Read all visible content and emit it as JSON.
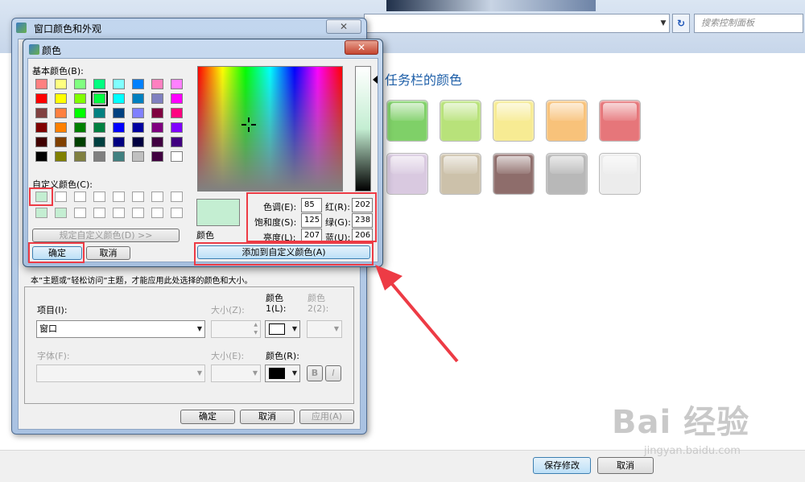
{
  "control_panel": {
    "search_placeholder": "搜索控制面板",
    "heading": "任务栏的颜色",
    "swatches_row1": [
      "#7fd068",
      "#b8e27a",
      "#f7eb93",
      "#f8c27a",
      "#e6767a"
    ],
    "swatches_row2": [
      "#d9c9e0",
      "#ccc1aa",
      "#8e6d6b",
      "#b8b8b8",
      "#ececec"
    ],
    "save_button": "保存修改",
    "cancel_button": "取消",
    "refresh_icon": "refresh-icon",
    "watermark": "Bai 经验",
    "watermark_url": "jingyan.baidu.com"
  },
  "window_color_dialog": {
    "title": "窗口颜色和外观",
    "close_label": "✕",
    "note": "本”主题或“轻松访问”主题，才能应用此处选择的颜色和大小。",
    "item_label": "项目(I):",
    "item_value": "窗口",
    "size_label_z": "大小(Z):",
    "color1_label": "颜色",
    "color1_sub": "1(L):",
    "color2_label": "颜色",
    "color2_sub": "2(2):",
    "font_label": "字体(F):",
    "size_label_e": "大小(E):",
    "font_color_label": "颜色(R):",
    "bold_label": "B",
    "italic_label": "I",
    "ok_button": "确定",
    "cancel_button": "取消",
    "apply_button": "应用(A)"
  },
  "color_dialog": {
    "title": "颜色",
    "close_label": "✕",
    "basic_colors_label": "基本颜色(B):",
    "custom_colors_label": "自定义颜色(C):",
    "define_custom_button": "规定自定义颜色(D) >>",
    "ok_button": "确定",
    "cancel_button": "取消",
    "preview_label": "颜色",
    "add_custom_button": "添加到自定义颜色(A)",
    "hue_label": "色调(E):",
    "hue_value": "85",
    "sat_label": "饱和度(S):",
    "sat_value": "125",
    "lum_label": "亮度(L):",
    "lum_value": "207",
    "red_label": "红(R):",
    "red_value": "202",
    "green_label": "绿(G):",
    "green_value": "238",
    "blue_label": "蓝(U):",
    "blue_value": "206",
    "selected_color": "#c4eed2",
    "basic_colors": [
      [
        "#ff8080",
        "#ffff80",
        "#80ff80",
        "#00ff80",
        "#80ffff",
        "#0080ff",
        "#ff80c0",
        "#ff80ff"
      ],
      [
        "#ff0000",
        "#ffff00",
        "#80ff00",
        "#00ff40",
        "#00ffff",
        "#0080c0",
        "#8080c0",
        "#ff00ff"
      ],
      [
        "#804040",
        "#ff8040",
        "#00ff00",
        "#008080",
        "#004080",
        "#8080ff",
        "#800040",
        "#ff0080"
      ],
      [
        "#800000",
        "#ff8000",
        "#008000",
        "#008040",
        "#0000ff",
        "#0000a0",
        "#800080",
        "#8000ff"
      ],
      [
        "#400000",
        "#804000",
        "#004000",
        "#004040",
        "#000080",
        "#000040",
        "#400040",
        "#400080"
      ],
      [
        "#000000",
        "#808000",
        "#808040",
        "#808080",
        "#408080",
        "#c0c0c0",
        "#400040",
        "#ffffff"
      ]
    ],
    "custom_colors": [
      [
        "#c4eed2",
        "#ffffff",
        "#ffffff",
        "#ffffff",
        "#ffffff",
        "#ffffff",
        "#ffffff",
        "#ffffff"
      ],
      [
        "#c4eed2",
        "#c4eed2",
        "#ffffff",
        "#ffffff",
        "#ffffff",
        "#ffffff",
        "#ffffff",
        "#ffffff"
      ]
    ]
  }
}
